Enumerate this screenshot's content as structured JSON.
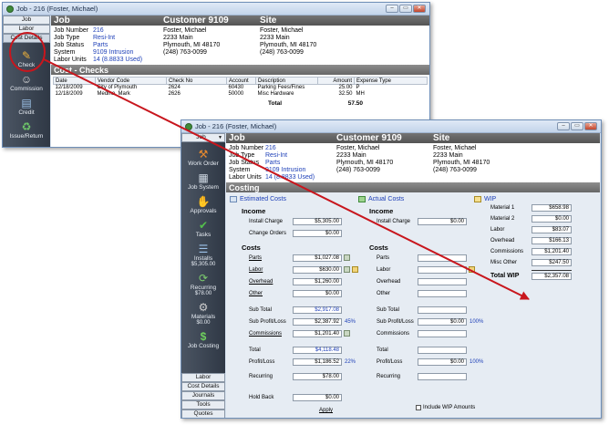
{
  "back_window": {
    "title": "Job - 216 (Foster, Michael)",
    "side_tabs": [
      "Job",
      "Labor",
      "Cost Details"
    ],
    "side_items": [
      "Check",
      "Commission",
      "Credit",
      "Issue/Return"
    ],
    "headers": {
      "job": "Job",
      "customer": "Customer 9109",
      "site": "Site"
    },
    "job_info": [
      {
        "label": "Job Number",
        "value": "216"
      },
      {
        "label": "Job Type",
        "value": "Resi-Int"
      },
      {
        "label": "Job Status",
        "value": "Parts"
      },
      {
        "label": "System",
        "value": "9109 Intrusion"
      },
      {
        "label": "Labor Units",
        "value": "14 (8.8833 Used)"
      }
    ],
    "customer_lines": [
      "Foster, Michael",
      "2233 Main",
      "Plymouth, MI 48170",
      "(248) 763-0099"
    ],
    "site_lines": [
      "Foster, Michael",
      "2233 Main",
      "Plymouth, MI 48170",
      "(248) 763-0099"
    ],
    "section_title": "Cost - Checks",
    "columns": [
      "Date",
      "Vendor Code",
      "Check No",
      "Account",
      "Description",
      "Amount",
      "Expense Type"
    ],
    "rows": [
      [
        "12/18/2009",
        "City of Plymouth",
        "2624",
        "60430",
        "Parking Fees/Fines",
        "25.00",
        "P"
      ],
      [
        "12/18/2009",
        "Medina, Mark",
        "2626",
        "50000",
        "Misc Hardware",
        "32.50",
        "MH"
      ]
    ],
    "total_label": "Total",
    "total_value": "57.50"
  },
  "front_window": {
    "title": "Job - 216 (Foster, Michael)",
    "side_top_tab": "Job",
    "side_items": [
      {
        "label": "Work Order",
        "sub": ""
      },
      {
        "label": "Job System",
        "sub": ""
      },
      {
        "label": "Approvals",
        "sub": ""
      },
      {
        "label": "Tasks",
        "sub": ""
      },
      {
        "label": "Installs",
        "sub": "$5,305.00"
      },
      {
        "label": "Recurring",
        "sub": "$78.00"
      },
      {
        "label": "Materials",
        "sub": "$0.00"
      },
      {
        "label": "Job Costing",
        "sub": ""
      }
    ],
    "side_bottom_tabs": [
      "Labor",
      "Cost Details",
      "Journals",
      "Tools",
      "Quotes"
    ],
    "headers": {
      "job": "Job",
      "customer": "Customer 9109",
      "site": "Site"
    },
    "job_info": [
      {
        "label": "Job Number",
        "value": "216"
      },
      {
        "label": "Job Type",
        "value": "Resi-Int"
      },
      {
        "label": "Job Status",
        "value": "Parts"
      },
      {
        "label": "System",
        "value": "9109 Intrusion"
      },
      {
        "label": "Labor Units",
        "value": "14 (8.8833 Used)"
      }
    ],
    "customer_lines": [
      "Foster, Michael",
      "2233 Main",
      "Plymouth, MI 48170",
      "(248) 763-0099"
    ],
    "site_lines": [
      "Foster, Michael",
      "2233 Main",
      "Plymouth, MI 48170",
      "(248) 763-0099"
    ],
    "costing_title": "Costing",
    "estimated": {
      "title": "Estimated Costs",
      "income": "Income",
      "install_charge": {
        "label": "Install Charge",
        "value": "$5,305.00"
      },
      "change_orders": {
        "label": "Change Orders",
        "value": "$0.00"
      },
      "costs": "Costs",
      "parts": {
        "label": "Parts",
        "value": "$1,027.08"
      },
      "labor": {
        "label": "Labor",
        "value": "$630.00"
      },
      "overhead": {
        "label": "Overhead",
        "value": "$1,260.00"
      },
      "other": {
        "label": "Other",
        "value": "$0.00"
      },
      "sub_total": {
        "label": "Sub Total",
        "value": "$2,917.08"
      },
      "sub_profit": {
        "label": "Sub Profit/Loss",
        "value": "$2,387.92",
        "pct": "45%"
      },
      "commissions": {
        "label": "Commissions",
        "value": "$1,201.40"
      },
      "total": {
        "label": "Total",
        "value": "$4,118.48"
      },
      "profit": {
        "label": "Profit/Loss",
        "value": "$1,186.52",
        "pct": "22%"
      },
      "recurring": {
        "label": "Recurring",
        "value": "$78.00"
      },
      "hold_back": {
        "label": "Hold Back",
        "value": "$0.00"
      },
      "apply": "Apply"
    },
    "actual": {
      "title": "Actual Costs",
      "income": "Income",
      "install_charge": {
        "label": "Install Charge",
        "value": "$0.00"
      },
      "costs": "Costs",
      "parts_label": "Parts",
      "labor_label": "Labor",
      "overhead_label": "Overhead",
      "other_label": "Other",
      "commissions_label": "Commissions",
      "sub_total_label": "Sub Total",
      "sub_profit": {
        "label": "Sub Profit/Loss",
        "value": "$0.00",
        "pct": "100%"
      },
      "total_label": "Total",
      "profit": {
        "label": "Profit/Loss",
        "value": "$0.00",
        "pct": "100%"
      },
      "recurring_label": "Recurring",
      "include_wip": "Include WIP Amounts"
    },
    "wip": {
      "title": "WIP",
      "rows": [
        {
          "label": "Material 1",
          "value": "$658.98"
        },
        {
          "label": "Material 2",
          "value": "$0.00"
        },
        {
          "label": "Labor",
          "value": "$83.07"
        },
        {
          "label": "Overhead",
          "value": "$166.13"
        },
        {
          "label": "Commissions",
          "value": "$1,201.40"
        },
        {
          "label": "Misc Other",
          "value": "$247.50"
        }
      ],
      "total": {
        "label": "Total WIP",
        "value": "$2,357.08"
      }
    }
  }
}
